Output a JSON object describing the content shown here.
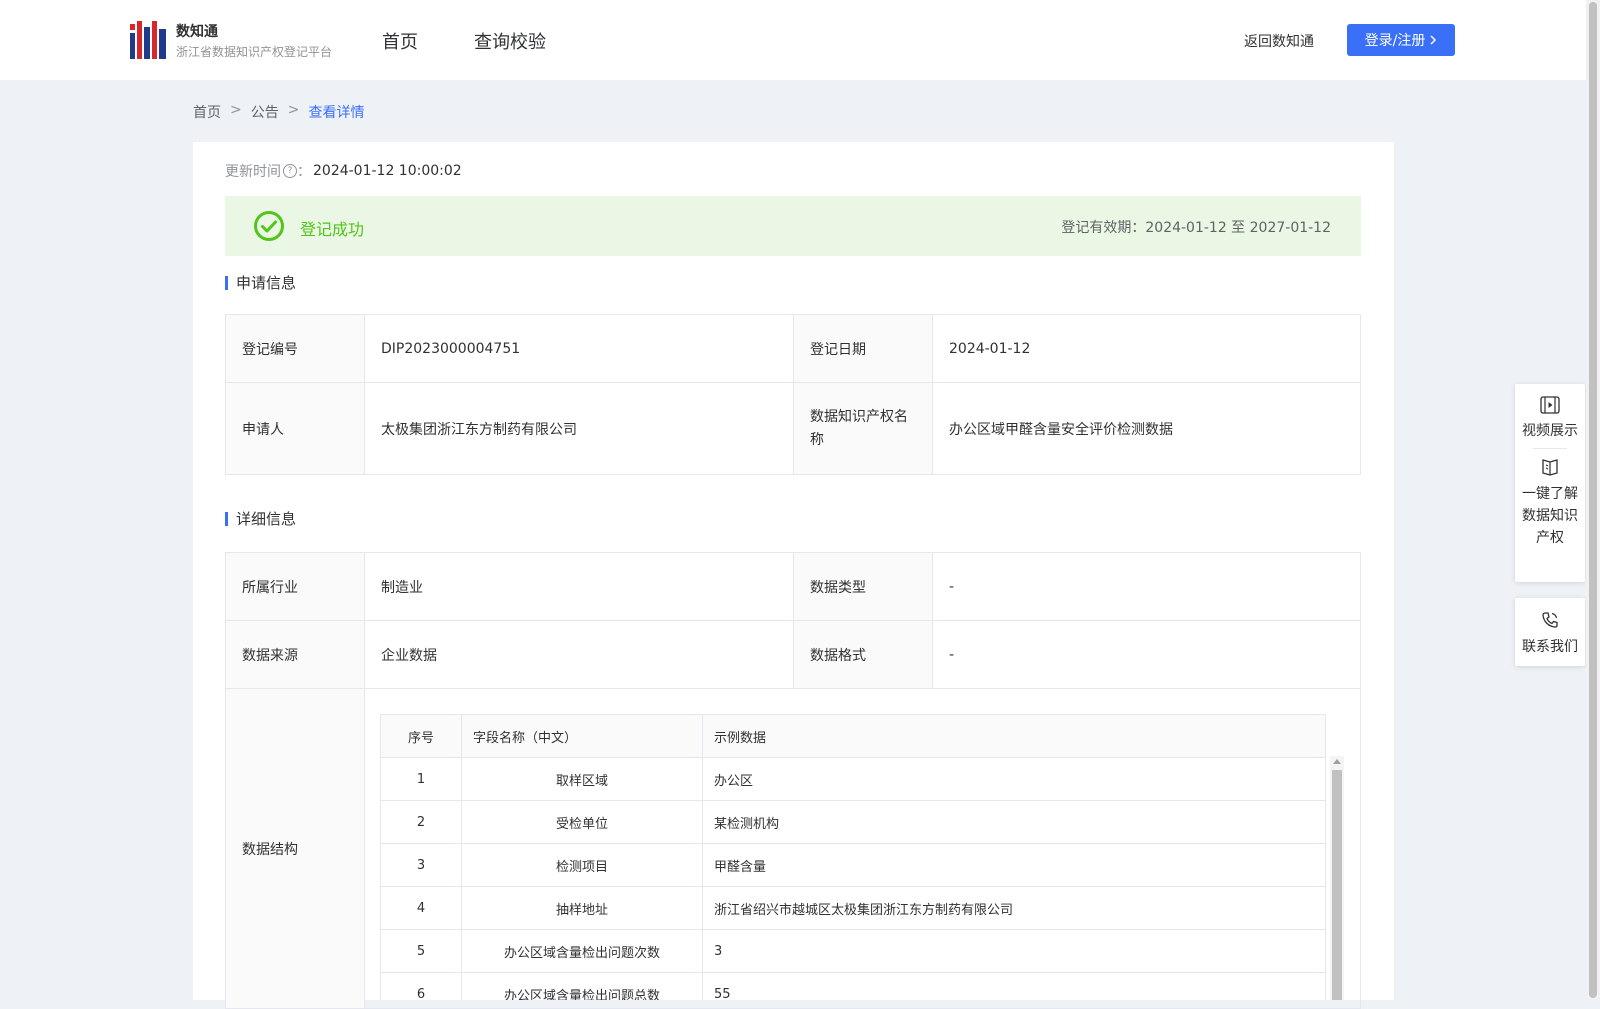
{
  "header": {
    "brand_name": "数知通",
    "brand_sub": "浙江省数据知识产权登记平台",
    "nav": [
      "首页",
      "查询校验"
    ],
    "back_link": "返回数知通",
    "login_label": "登录/注册"
  },
  "breadcrumb": [
    "首页",
    "公告",
    "查看详情"
  ],
  "update": {
    "label": "更新时间",
    "value": "2024-01-12 10:00:02"
  },
  "status": {
    "text": "登记成功",
    "valid_label": "登记有效期：",
    "valid_range": "2024-01-12 至 2027-01-12"
  },
  "apply_section": {
    "title": "申请信息",
    "rows": [
      {
        "label1": "登记编号",
        "value1": "DIP2023000004751",
        "label2": "登记日期",
        "value2": "2024-01-12"
      },
      {
        "label1": "申请人",
        "value1": "太极集团浙江东方制药有限公司",
        "label2": "数据知识产权名称",
        "value2": "办公区域甲醛含量安全评价检测数据"
      }
    ]
  },
  "detail_section": {
    "title": "详细信息",
    "rows": [
      {
        "label1": "所属行业",
        "value1": "制造业",
        "label2": "数据类型",
        "value2": "-"
      },
      {
        "label1": "数据来源",
        "value1": "企业数据",
        "label2": "数据格式",
        "value2": "-"
      }
    ],
    "structure_label": "数据结构"
  },
  "structure_table": {
    "headers": [
      "序号",
      "字段名称（中文）",
      "示例数据"
    ],
    "rows": [
      [
        "1",
        "取样区域",
        "办公区"
      ],
      [
        "2",
        "受检单位",
        "某检测机构"
      ],
      [
        "3",
        "检测项目",
        "甲醛含量"
      ],
      [
        "4",
        "抽样地址",
        "浙江省绍兴市越城区太极集团浙江东方制药有限公司"
      ],
      [
        "5",
        "办公区域含量检出问题次数",
        "3"
      ],
      [
        "6",
        "办公区域含量检出问题总数",
        "55"
      ]
    ]
  },
  "float_widget": {
    "video": "视频展示",
    "learn": "一键了解数据知识产权",
    "contact": "联系我们"
  },
  "colors": {
    "accent": "#3a6ff7",
    "success": "#52c41a",
    "success_bg": "#eaf7e4"
  }
}
